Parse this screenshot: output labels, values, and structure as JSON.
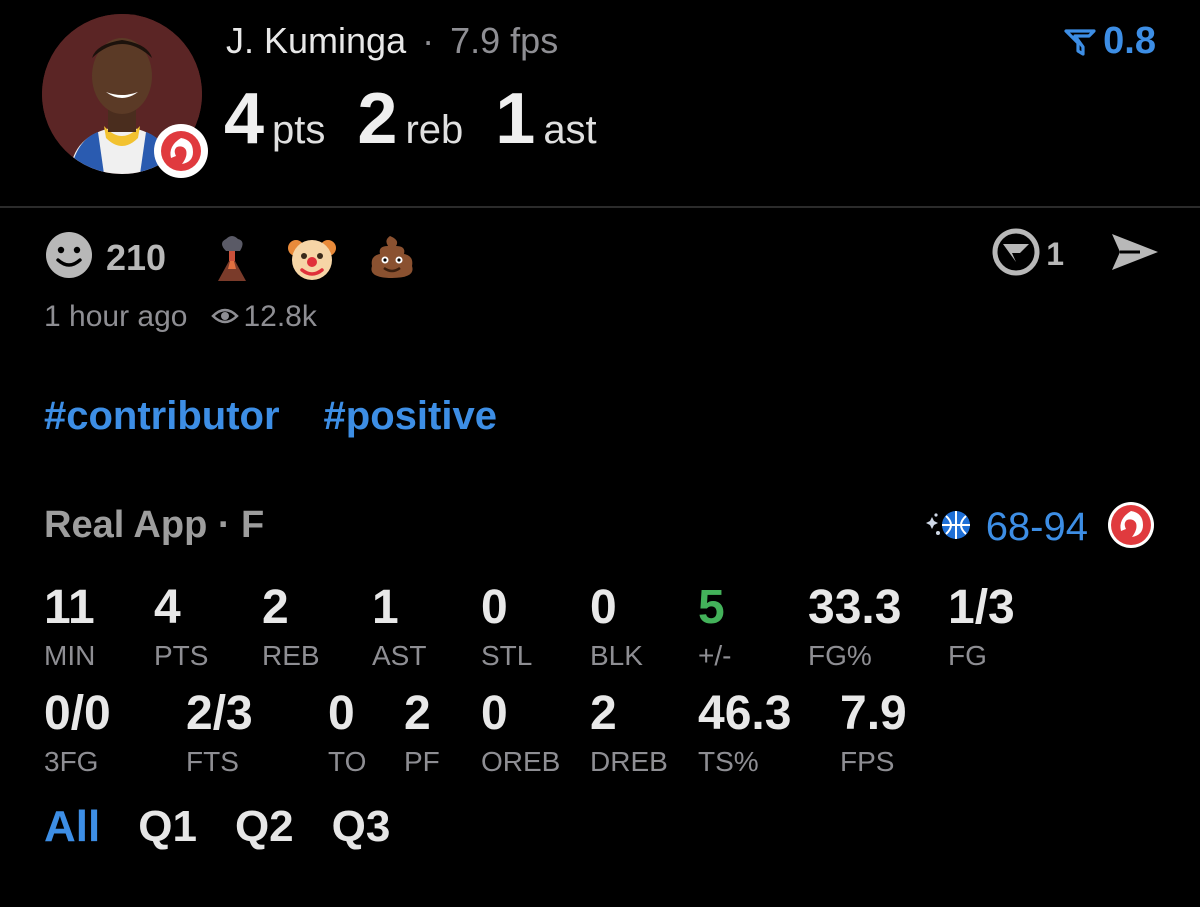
{
  "player": {
    "name": "J. Kuminga",
    "sep": "·",
    "fps": "7.9 fps",
    "pts": "4",
    "pts_label": "pts",
    "reb": "2",
    "reb_label": "reb",
    "ast": "1",
    "ast_label": "ast"
  },
  "filter": {
    "value": "0.8",
    "icon": "filter-icon"
  },
  "reactions": {
    "count": "210",
    "emojis": [
      "volcano",
      "clown",
      "poop"
    ],
    "comments": "1"
  },
  "meta": {
    "time": "1 hour ago",
    "views": "12.8k"
  },
  "tags": [
    "#contributor",
    "#positive"
  ],
  "game": {
    "source": "Real App · F",
    "score": "68-94"
  },
  "stats_row1": [
    {
      "value": "11",
      "label": "MIN"
    },
    {
      "value": "4",
      "label": "PTS"
    },
    {
      "value": "2",
      "label": "REB"
    },
    {
      "value": "1",
      "label": "AST"
    },
    {
      "value": "0",
      "label": "STL"
    },
    {
      "value": "0",
      "label": "BLK"
    },
    {
      "value": "5",
      "label": "+/-"
    },
    {
      "value": "33.3",
      "label": "FG%"
    },
    {
      "value": "1/3",
      "label": "FG"
    }
  ],
  "stats_row2": [
    {
      "value": "0/0",
      "label": "3FG"
    },
    {
      "value": "2/3",
      "label": "FTS"
    },
    {
      "value": "0",
      "label": "TO"
    },
    {
      "value": "2",
      "label": "PF"
    },
    {
      "value": "0",
      "label": "OREB"
    },
    {
      "value": "2",
      "label": "DREB"
    },
    {
      "value": "46.3",
      "label": "TS%"
    },
    {
      "value": "7.9",
      "label": "FPS"
    }
  ],
  "tabs": [
    "All",
    "Q1",
    "Q2",
    "Q3"
  ],
  "colors": {
    "accent": "#3d8ee5",
    "positive": "#43b25a",
    "hawks_red": "#e03a3e"
  }
}
